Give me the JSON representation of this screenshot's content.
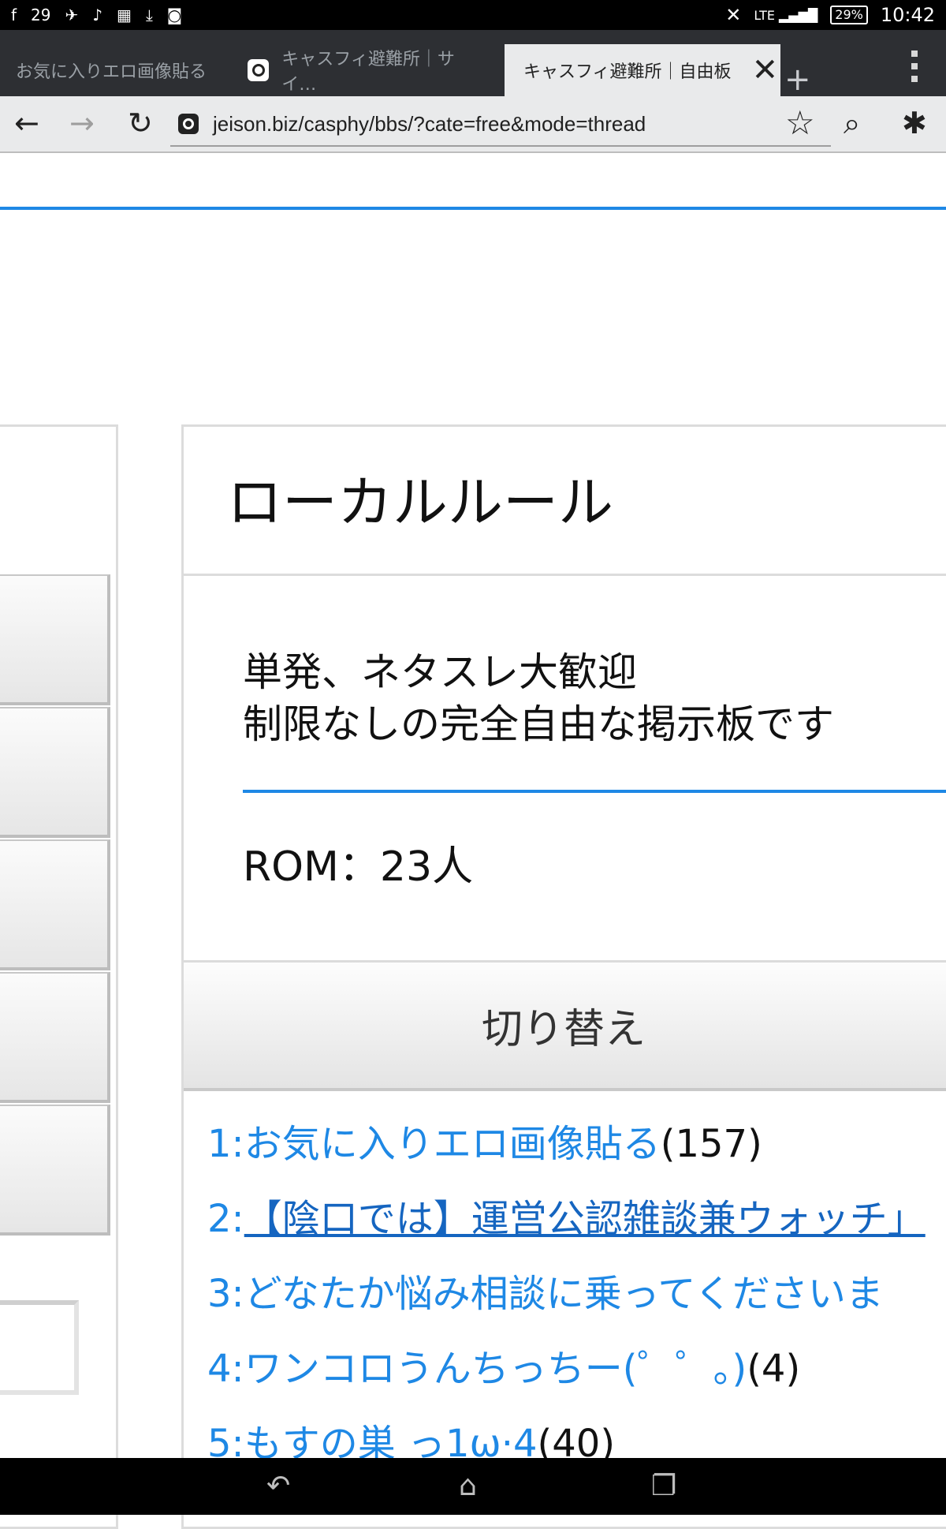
{
  "status_bar": {
    "time": "10:42",
    "battery": "29%",
    "left_icons": [
      "facebook-icon",
      "notification-29-icon",
      "bird-icon",
      "music-note-icon",
      "keyboard-icon",
      "download-icon",
      "app-icon"
    ],
    "network": "LTE"
  },
  "tabs": [
    {
      "label": "お気に入りエロ画像貼る",
      "active": false
    },
    {
      "label": "キャスフィ避難所｜サイ…",
      "active": false
    },
    {
      "label": "キャスフィ避難所｜自由板",
      "active": true
    }
  ],
  "address": {
    "url": "jeison.biz/casphy/bbs/?cate=free&mode=thread"
  },
  "panel": {
    "title": "ローカルルール",
    "rules_line1": "単発、ネタスレ大歓迎",
    "rules_line2": "制限なしの完全自由な掲示板です",
    "rom": "ROM：23人",
    "switch_label": "切り替え"
  },
  "threads": [
    {
      "num": "1:",
      "title": "お気に入りエロ画像貼る",
      "count": "(157)",
      "visited": false
    },
    {
      "num": "2:",
      "title": "【陰口では】運営公認雑談兼ウォッチ」",
      "count": "",
      "visited": true
    },
    {
      "num": "3:",
      "title": "どなたか悩み相談に乗ってくださいま",
      "count": "",
      "visited": false
    },
    {
      "num": "4:",
      "title": "ワンコロうんちっちー(゜゜。)",
      "count": "(4)",
      "visited": false
    },
    {
      "num": "5:",
      "title": "もすの巣 っ1ω·4",
      "count": "(40)",
      "visited": false
    }
  ],
  "colors": {
    "accent": "#1e88e5",
    "status_bar": "#000000",
    "tab_strip": "#2d2f33"
  }
}
